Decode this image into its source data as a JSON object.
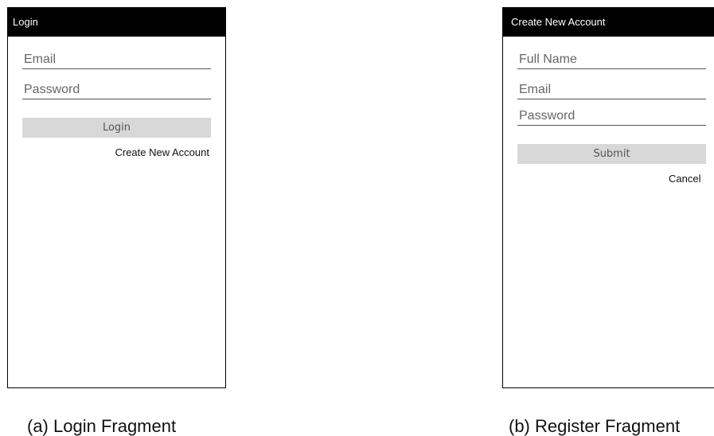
{
  "login": {
    "title": "Login",
    "email_placeholder": "Email",
    "password_placeholder": "Password",
    "login_button": "Login",
    "create_account_link": "Create New Account",
    "caption": "(a) Login Fragment"
  },
  "register": {
    "title": "Create New Account",
    "fullname_placeholder": "Full Name",
    "email_placeholder": "Email",
    "password_placeholder": "Password",
    "submit_button": "Submit",
    "cancel_link": "Cancel",
    "caption": "(b) Register Fragment"
  },
  "colors": {
    "titlebar": "#000000",
    "button": "#d8d8d8"
  }
}
